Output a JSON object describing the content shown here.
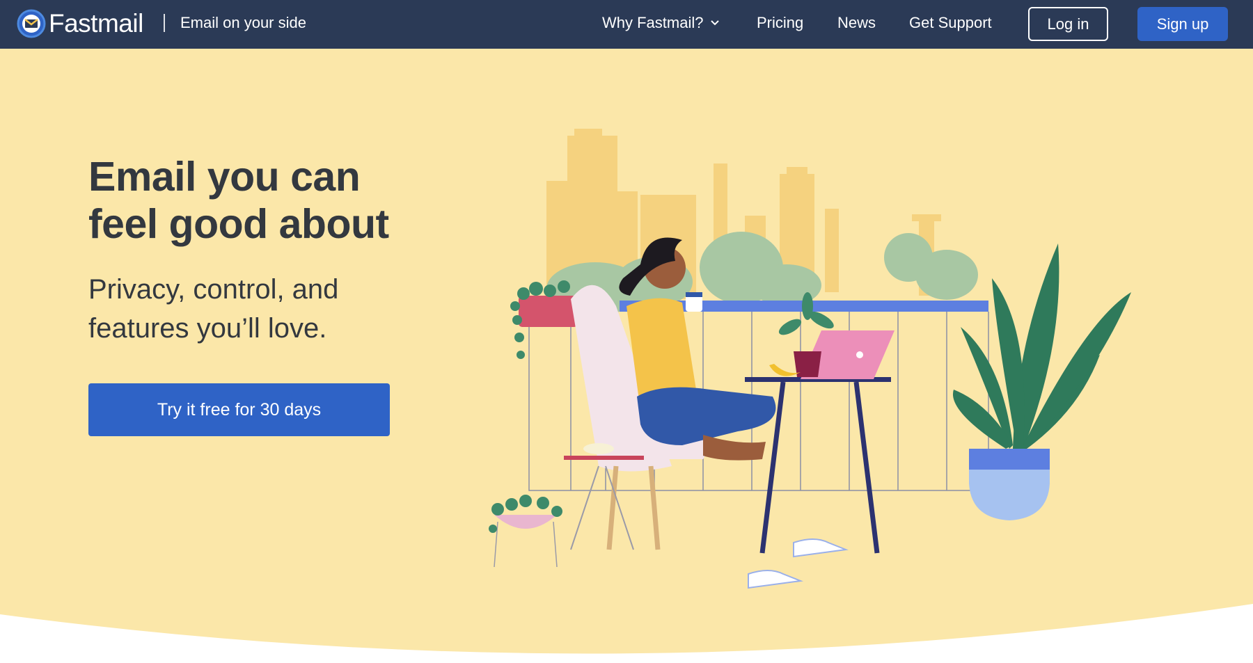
{
  "nav": {
    "brand": "Fastmail",
    "tagline": "Email on your side",
    "links": {
      "why": "Why Fastmail?",
      "pricing": "Pricing",
      "news": "News",
      "support": "Get Support"
    },
    "login_label": "Log in",
    "signup_label": "Sign up"
  },
  "hero": {
    "headline_line1": "Email you can",
    "headline_line2": "feel good about",
    "subhead_line1": "Privacy, control, and",
    "subhead_line2": "features you’ll love.",
    "cta_label": "Try it free for 30 days"
  },
  "colors": {
    "nav_bg": "#2b3a56",
    "hero_bg": "#fbe7a9",
    "accent": "#2f63c6",
    "text": "#33383f"
  },
  "icons": {
    "logo": "fastmail-logo-icon",
    "dropdown": "chevron-down-icon"
  }
}
